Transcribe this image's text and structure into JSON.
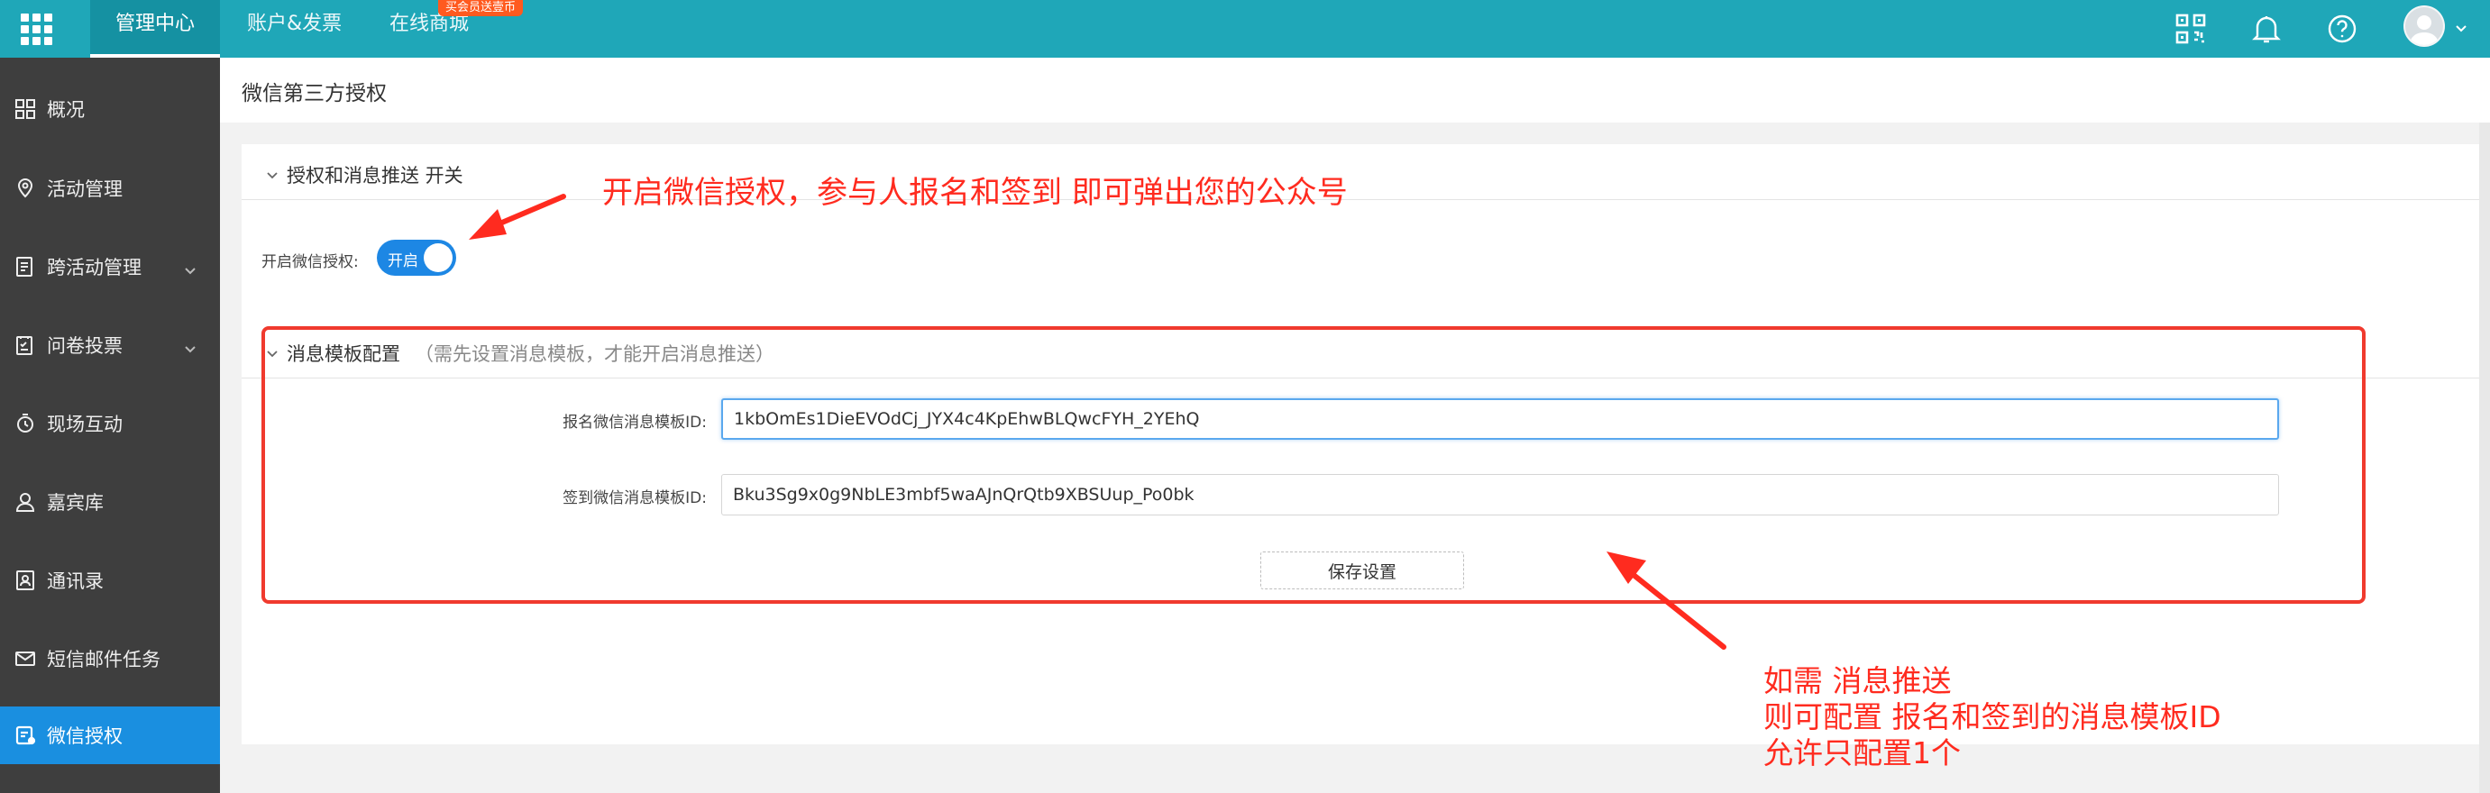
{
  "topbar": {
    "tabs": [
      {
        "label": "管理中心",
        "active": true
      },
      {
        "label": "账户&发票",
        "active": false
      },
      {
        "label": "在线商城",
        "active": false
      }
    ],
    "promo_badge": "买会员送壹币",
    "icons": [
      "qr-code-icon",
      "bell-icon",
      "help-icon",
      "avatar",
      "chevron-down-icon"
    ]
  },
  "sidebar": {
    "items": [
      {
        "label": "概况",
        "icon": "dashboard-icon",
        "expandable": false,
        "active": false
      },
      {
        "label": "活动管理",
        "icon": "activity-icon",
        "expandable": false,
        "active": false
      },
      {
        "label": "跨活动管理",
        "icon": "cross-activity-icon",
        "expandable": true,
        "active": false
      },
      {
        "label": "问卷投票",
        "icon": "survey-icon",
        "expandable": true,
        "active": false
      },
      {
        "label": "现场互动",
        "icon": "interaction-icon",
        "expandable": false,
        "active": false
      },
      {
        "label": "嘉宾库",
        "icon": "guest-icon",
        "expandable": false,
        "active": false
      },
      {
        "label": "通讯录",
        "icon": "contacts-icon",
        "expandable": false,
        "active": false
      },
      {
        "label": "短信邮件任务",
        "icon": "mail-icon",
        "expandable": false,
        "active": false
      },
      {
        "label": "微信授权",
        "icon": "wechat-auth-icon",
        "expandable": false,
        "active": true
      }
    ]
  },
  "main": {
    "page_title": "微信第三方授权",
    "auth_section": {
      "title": "授权和消息推送 开关",
      "switch_label": "开启微信授权:",
      "switch_text": "开启",
      "switch_on": true
    },
    "template_section": {
      "title": "消息模板配置",
      "note": "（需先设置消息模板，才能开启消息推送）",
      "signup_label": "报名微信消息模板ID:",
      "signup_value": "1kbOmEs1DieEVOdCj_JYX4c4KpEhwBLQwcFYH_2YEhQ",
      "checkin_label": "签到微信消息模板ID:",
      "checkin_value": "Bku3Sg9x0g9NbLE3mbf5waAJnQrQtb9XBSUup_Po0bk",
      "save_label": "保存设置"
    }
  },
  "annotations": {
    "top_note": "开启微信授权，参与人报名和签到 即可弹出您的公众号",
    "bottom_note": [
      "如需 消息推送",
      "则可配置 报名和签到的消息模板ID",
      "允许只配置1个"
    ],
    "color": "#ff2b1f"
  },
  "colors": {
    "topbar": "#1fa7b8",
    "sidebar": "#3e3e3e",
    "sidebar_active": "#1a8fe0",
    "switch_on": "#1d87e4"
  }
}
